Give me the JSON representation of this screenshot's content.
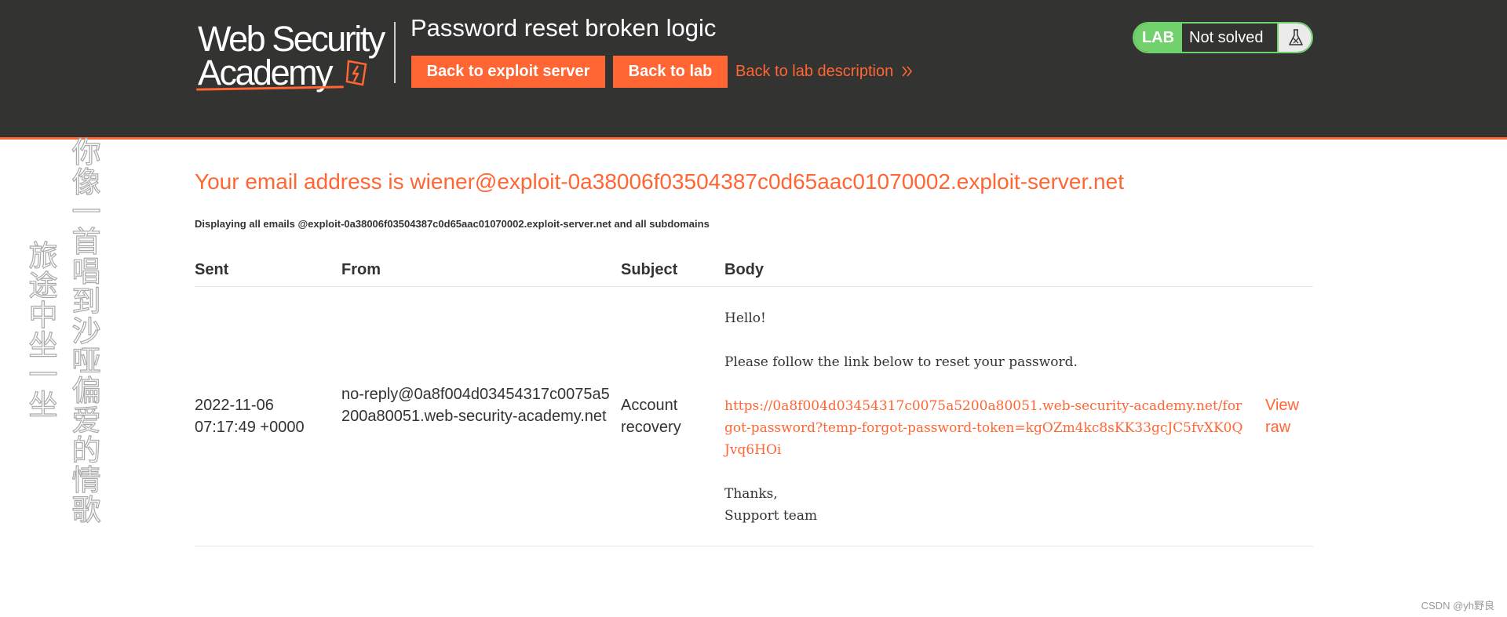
{
  "header": {
    "logo": {
      "line1": "Web Security",
      "line2": "Academy"
    },
    "lab_title": "Password reset broken logic",
    "buttons": {
      "back_to_exploit_server": "Back to exploit server",
      "back_to_lab": "Back to lab"
    },
    "lab_description_link": "Back to lab description",
    "status": {
      "badge": "LAB",
      "text": "Not solved",
      "icon": "flask-icon"
    }
  },
  "main": {
    "email_heading": "Your email address is wiener@exploit-0a38006f03504387c0d65aac01070002.exploit-server.net",
    "display_note": "Displaying all emails @exploit-0a38006f03504387c0d65aac01070002.exploit-server.net and all subdomains",
    "table": {
      "headers": [
        "Sent",
        "From",
        "Subject",
        "Body"
      ],
      "rows": [
        {
          "sent": "2022-11-06 07:17:49 +0000",
          "from": "no-reply@0a8f004d03454317c0075a5200a80051.web-security-academy.net",
          "subject": "Account recovery",
          "body": {
            "greeting": "Hello!",
            "instruction": "Please follow the link below to reset your password.",
            "link": "https://0a8f004d03454317c0075a5200a80051.web-security-academy.net/forgot-password?temp-forgot-password-token=kgOZm4kc8sKK33gcJC5fvXK0QJvq6HOi",
            "signoff": "Thanks,",
            "signature": "Support team"
          },
          "view_raw": "View raw"
        }
      ]
    }
  },
  "overlay": {
    "poem_right": "你像一首唱到沙哑偏爱的情歌",
    "poem_left": "旅途中坐一坐",
    "watermark": "CSDN @yh野良"
  },
  "colors": {
    "header_bg": "#333332",
    "accent": "#ff6633",
    "status_green": "#70d16d",
    "text": "#333332"
  }
}
